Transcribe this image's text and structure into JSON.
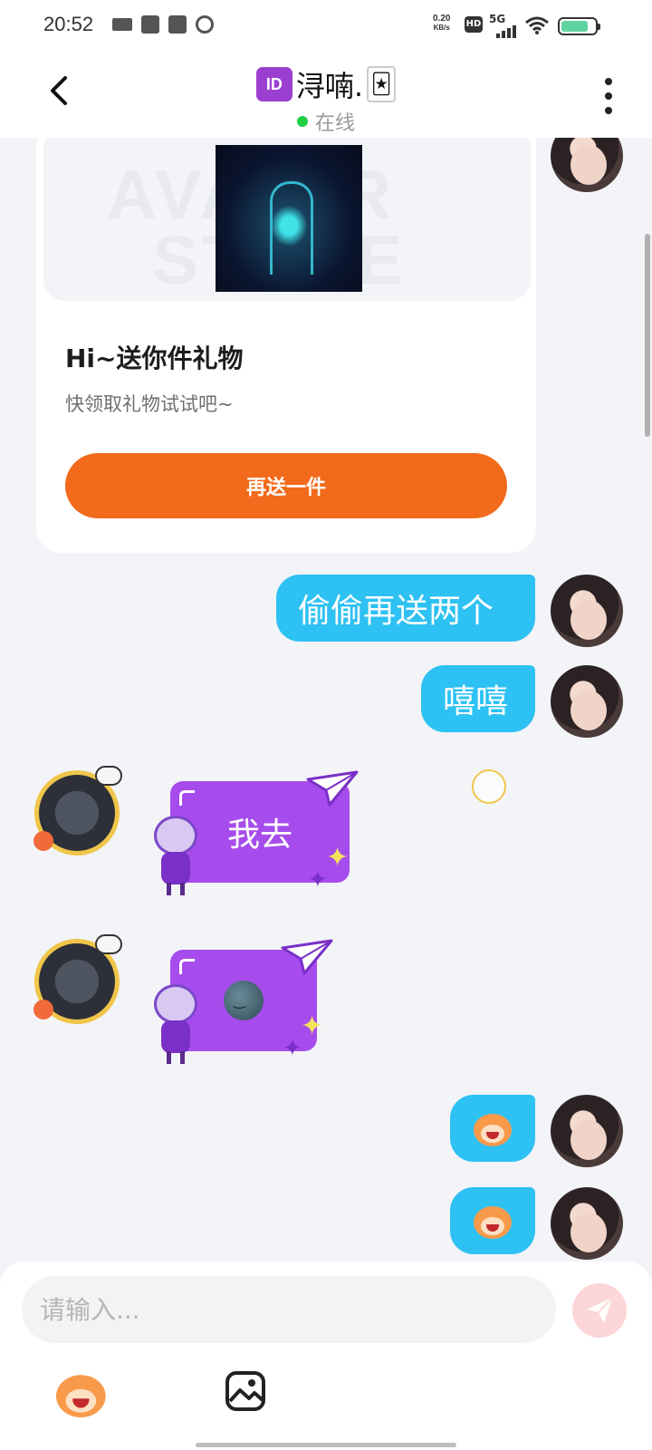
{
  "status_bar": {
    "time": "20:52",
    "net_speed_value": "0.20",
    "net_speed_unit": "KB/s",
    "hd_label": "HD",
    "network_label": "5G",
    "battery_level": 0.8
  },
  "header": {
    "title": "浔喃.",
    "id_badge": "ID",
    "status_text": "在线",
    "status_color": "#22d046"
  },
  "gift_card": {
    "title": "Hi~送你件礼物",
    "subtitle": "快领取礼物试试吧~",
    "button_label": "再送一件",
    "button_color": "#f26a1b"
  },
  "messages": [
    {
      "side": "right",
      "type": "text",
      "text": "偷偷再送两个"
    },
    {
      "side": "right",
      "type": "text",
      "text": "嘻嘻"
    },
    {
      "side": "left",
      "type": "sticker-text",
      "text": "我去"
    },
    {
      "side": "left",
      "type": "sticker-emoji",
      "icon": "moon-face-emoji"
    },
    {
      "side": "right",
      "type": "emoji",
      "icon": "monkey-emoji"
    },
    {
      "side": "right",
      "type": "emoji",
      "icon": "monkey-emoji"
    }
  ],
  "input": {
    "placeholder": "请输入...",
    "value": ""
  },
  "toolbar": {
    "emoji_icon": "monkey-emoji-icon",
    "image_icon": "image-icon",
    "send_icon": "send-icon"
  },
  "colors": {
    "outgoing_bubble": "#2ec1f3",
    "incoming_bubble": "#a64cec",
    "background": "#f3f4f8"
  }
}
